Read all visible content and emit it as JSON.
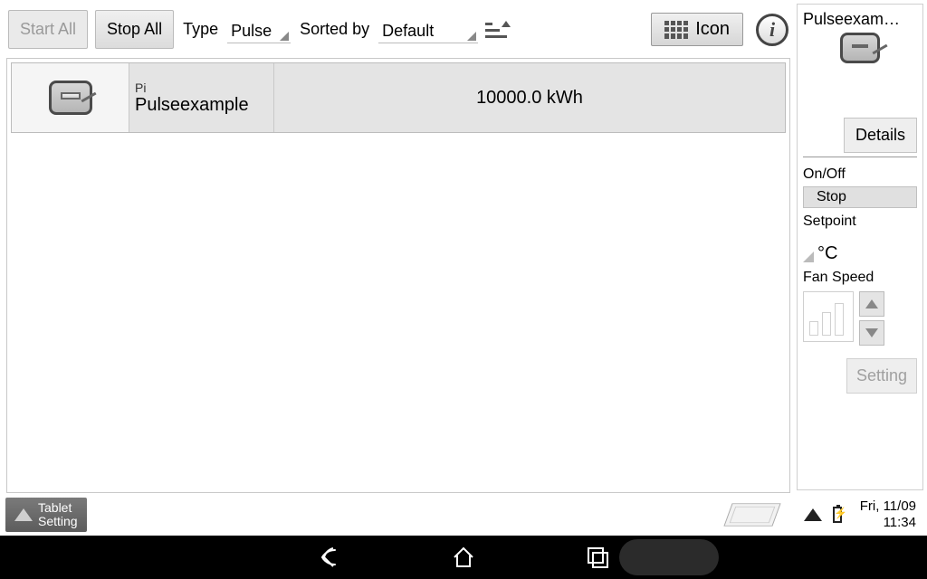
{
  "toolbar": {
    "start_all": "Start All",
    "stop_all": "Stop All",
    "type_label": "Type",
    "type_value": "Pulse",
    "sorted_label": "Sorted by",
    "sorted_value": "Default",
    "icon_button": "Icon"
  },
  "list": {
    "items": [
      {
        "tag": "Pi",
        "name": "Pulseexample",
        "value": "10000.0 kWh"
      }
    ]
  },
  "side": {
    "title": "Pulseexam…",
    "details": "Details",
    "onoff_label": "On/Off",
    "onoff_value": "Stop",
    "setpoint_label": "Setpoint",
    "setpoint_unit": "°C",
    "fanspeed_label": "Fan Speed",
    "setting": "Setting"
  },
  "footer": {
    "tablet_setting_line1": "Tablet",
    "tablet_setting_line2": "Setting",
    "date": "Fri, 11/09",
    "time": "11:34"
  }
}
